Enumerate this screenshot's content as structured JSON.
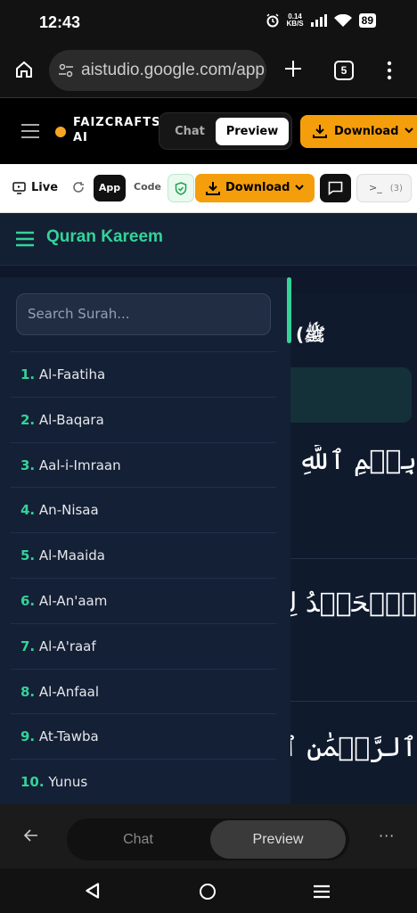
{
  "status_bar": {
    "time": "12:43",
    "net_speed": "0.14",
    "net_unit": "KB/S",
    "battery": "89"
  },
  "browser": {
    "url": "aistudio.google.com/app",
    "tab_count": "5"
  },
  "app_header": {
    "brand_line1": "FAIZCRAFTS",
    "brand_line2": "AI",
    "mode_chat": "Chat",
    "mode_preview": "Preview",
    "download_label": "Download"
  },
  "toolbar": {
    "live_label": "Live",
    "app_label": "App",
    "code_label": "Code",
    "download_label": "Download",
    "terminal_label": ">_",
    "terminal_count": "(3)"
  },
  "quran": {
    "title": "Quran Kareem",
    "search_placeholder": "Search Surah...",
    "main_heading_fragment": "(ﷺ",
    "surahs": [
      {
        "num": "1.",
        "name": "Al-Faatiha"
      },
      {
        "num": "2.",
        "name": "Al-Baqara"
      },
      {
        "num": "3.",
        "name": "Aal-i-Imraan"
      },
      {
        "num": "4.",
        "name": "An-Nisaa"
      },
      {
        "num": "5.",
        "name": "Al-Maaida"
      },
      {
        "num": "6.",
        "name": "Al-An'aam"
      },
      {
        "num": "7.",
        "name": "Al-A'raaf"
      },
      {
        "num": "8.",
        "name": "Al-Anfaal"
      },
      {
        "num": "9.",
        "name": "At-Tawba"
      },
      {
        "num": "10.",
        "name": "Yunus"
      }
    ],
    "verses": [
      "بِسۡمِ ٱللَّهِ ٱلرَّحۡ",
      "ٱلۡحَمۡدُ لِلَّهِ رَبِّ",
      "ٱلرَّحۡمَٰنِ ٱلرَّحِيمِ"
    ]
  },
  "bottom_nav": {
    "chat": "Chat",
    "preview": "Preview",
    "more": "···"
  },
  "colors": {
    "accent_green": "#34d399",
    "download_orange": "#f59e0b",
    "panel_bg": "#142036"
  }
}
